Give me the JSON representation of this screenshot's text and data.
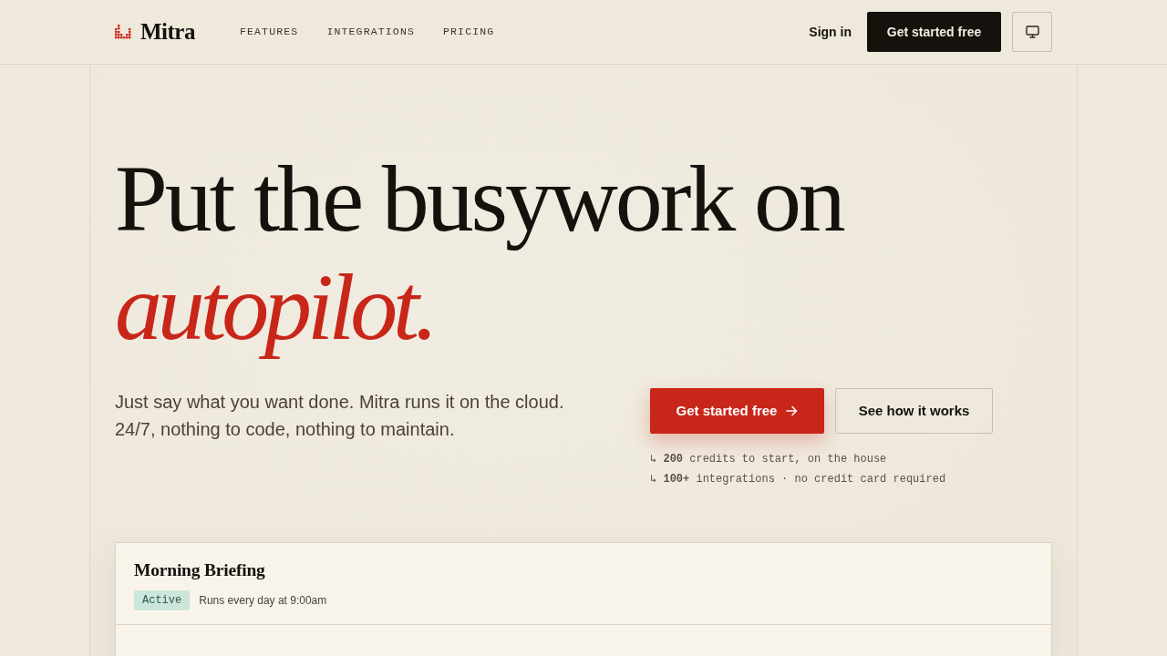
{
  "nav": {
    "brand": "Mitra",
    "links": [
      {
        "label": "FEATURES"
      },
      {
        "label": "INTEGRATIONS"
      },
      {
        "label": "PRICING"
      }
    ],
    "sign_in": "Sign in",
    "cta": "Get started free"
  },
  "hero": {
    "headline": "Put the busywork on",
    "headline_accent": "autopilot.",
    "lede_lines": [
      "Just say what you want done. Mitra runs it on the cloud.",
      "24/7, nothing to code, nothing to maintain."
    ],
    "primary_button": "Get started free",
    "secondary_button": "See how it works",
    "notes": [
      "↳ **200** credits to start, on the house",
      "↳ **100+** integrations · no credit card required"
    ]
  },
  "card": {
    "title": "Morning Briefing",
    "status": "Active",
    "schedule": "Runs every day at 9:00am"
  }
}
